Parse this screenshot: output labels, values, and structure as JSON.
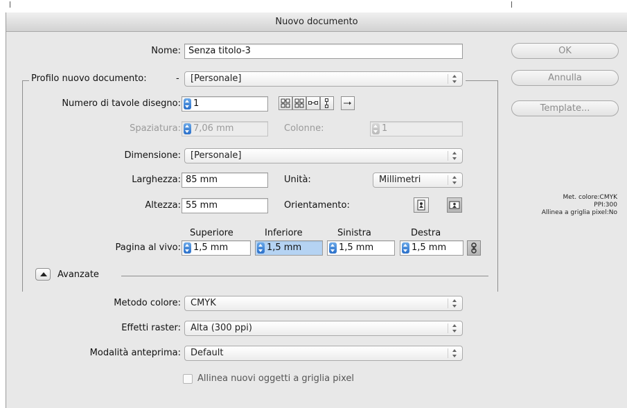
{
  "dialog": {
    "title": "Nuovo documento"
  },
  "buttons": {
    "ok": "OK",
    "cancel": "Annulla",
    "template": "Template..."
  },
  "form": {
    "name_label": "Nome:",
    "name_value": "Senza titolo-3",
    "profile_label": "Profilo nuovo documento:",
    "profile_value": "[Personale]",
    "artboards_label": "Numero di tavole disegno:",
    "artboards_value": "1",
    "spacing_label": "Spaziatura:",
    "spacing_value": "7,06 mm",
    "columns_label": "Colonne:",
    "columns_value": "1",
    "size_label": "Dimensione:",
    "size_value": "[Personale]",
    "width_label": "Larghezza:",
    "width_value": "85 mm",
    "units_label": "Unità:",
    "units_value": "Millimetri",
    "height_label": "Altezza:",
    "height_value": "55 mm",
    "orientation_label": "Orientamento:",
    "bleed_label": "Pagina al vivo:",
    "bleed_headers": [
      "Superiore",
      "Inferiore",
      "Sinistra",
      "Destra"
    ],
    "bleed_values": [
      "1,5 mm",
      "1,5 mm",
      "1,5 mm",
      "1,5 mm"
    ]
  },
  "advanced": {
    "label": "Avanzate",
    "color_mode_label": "Metodo colore:",
    "color_mode_value": "CMYK",
    "raster_label": "Effetti raster:",
    "raster_value": "Alta (300 ppi)",
    "preview_label": "Modalità anteprima:",
    "preview_value": "Default",
    "pixel_grid_label": "Allinea nuovi oggetti a griglia pixel"
  },
  "info": {
    "color": "Met. colore:CMYK",
    "ppi": "PPI:300",
    "pixel_grid": "Allinea a griglia pixel:No"
  },
  "icons": {
    "arrange_grid": "grid-by-row-icon",
    "arrange_col": "grid-by-column-icon",
    "arrange_row": "arrange-by-row-icon",
    "arrange_column": "arrange-by-column-icon",
    "direction": "right-arrow-icon",
    "portrait": "portrait-icon",
    "landscape": "landscape-icon",
    "link": "chain-link-icon",
    "disclosure": "disclosure-triangle-icon"
  },
  "colors": {
    "accent": "#3a7fd6",
    "window_bg": "#e8e8e8",
    "selection": "#b5d3f3"
  }
}
